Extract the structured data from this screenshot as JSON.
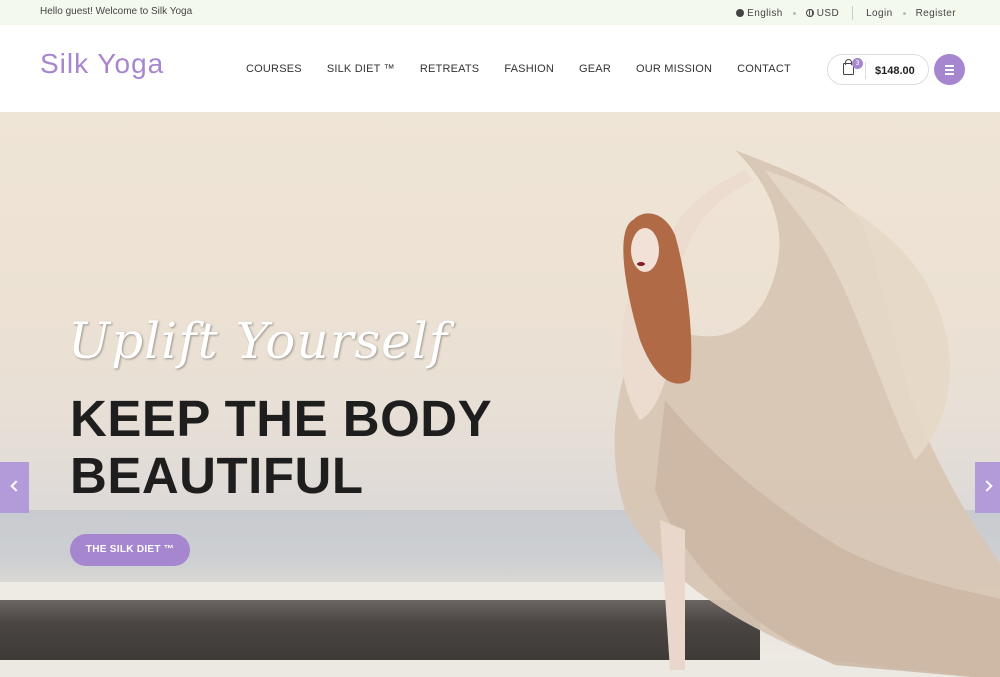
{
  "topbar": {
    "welcome": "Hello guest! Welcome to Silk Yoga",
    "language": "English",
    "currency": "USD",
    "login": "Login",
    "register": "Register"
  },
  "header": {
    "logo": "Silk Yoga",
    "nav": [
      "COURSES",
      "SILK DIET ™",
      "RETREATS",
      "FASHION",
      "GEAR",
      "OUR MISSION",
      "CONTACT"
    ],
    "cart": {
      "count": "3",
      "total": "$148.00",
      "icon": "shopping-bag-icon"
    },
    "menu_icon": "hamburger-icon"
  },
  "hero": {
    "script_text": "Uplift Yourself",
    "headline_line1": "KEEP THE BODY",
    "headline_line2": "BEAUTIFUL",
    "cta": "THE SILK DIET ™",
    "prev_icon": "chevron-left-icon",
    "next_icon": "chevron-right-icon"
  },
  "colors": {
    "accent": "#a686cf",
    "topbar_bg": "#f4f9ee",
    "headline": "#1e1e1e"
  }
}
